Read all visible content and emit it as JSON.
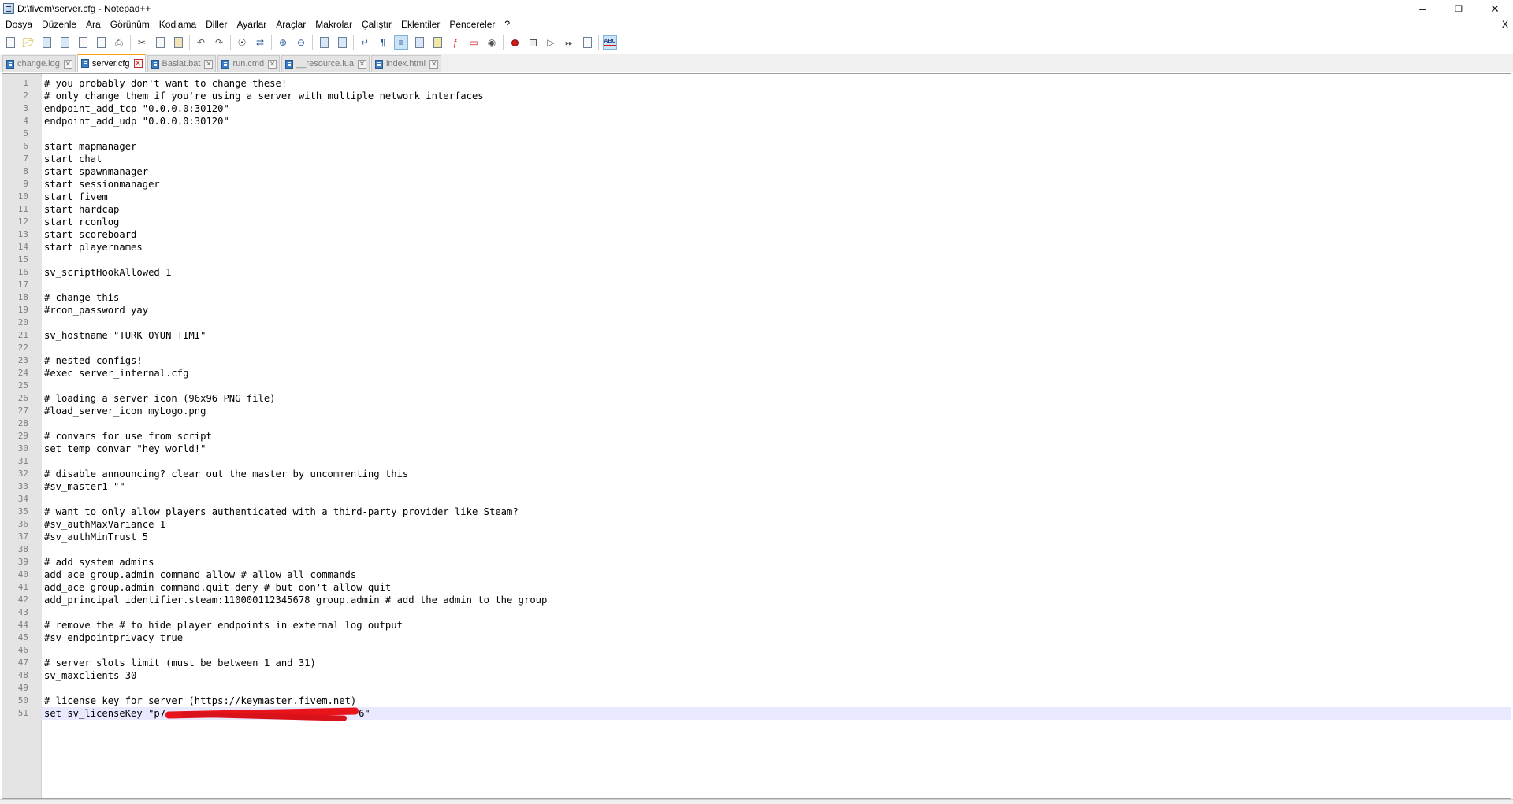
{
  "window": {
    "title": "D:\\fivem\\server.cfg - Notepad++",
    "minimize_icon": "minimize-icon",
    "maximize_icon": "restore-icon",
    "close_icon": "close-icon"
  },
  "menu": {
    "items": [
      "Dosya",
      "Düzenle",
      "Ara",
      "Görünüm",
      "Kodlama",
      "Diller",
      "Ayarlar",
      "Araçlar",
      "Makrolar",
      "Çalıştır",
      "Eklentiler",
      "Pencereler",
      "?"
    ],
    "close_label": "X"
  },
  "toolbar": {
    "icons": [
      "new-file-icon",
      "open-file-icon",
      "save-icon",
      "save-all-icon",
      "close-icon",
      "close-all-icon",
      "print-icon",
      "cut-icon",
      "copy-icon",
      "paste-icon",
      "undo-icon",
      "redo-icon",
      "find-icon",
      "replace-icon",
      "zoom-in-icon",
      "zoom-out-icon",
      "sync-vertical-icon",
      "sync-horizontal-icon",
      "word-wrap-icon",
      "show-all-chars-icon",
      "indent-guide-icon",
      "doc-map-icon",
      "function-list-icon",
      "folder-workspace-icon",
      "monitoring-icon",
      "eye-icon",
      "record-macro-icon",
      "stop-macro-icon",
      "play-macro-icon",
      "run-macro-multiple-icon",
      "save-macro-icon",
      "spell-check-icon"
    ]
  },
  "tabs": [
    {
      "label": "change.log",
      "active": false
    },
    {
      "label": "server.cfg",
      "active": true
    },
    {
      "label": "Baslat.bat",
      "active": false
    },
    {
      "label": "run.cmd",
      "active": false
    },
    {
      "label": "__resource.lua",
      "active": false
    },
    {
      "label": "index.html",
      "active": false
    }
  ],
  "editor": {
    "current_line": 51,
    "lines": [
      "# you probably don't want to change these!",
      "# only change them if you're using a server with multiple network interfaces",
      "endpoint_add_tcp \"0.0.0.0:30120\"",
      "endpoint_add_udp \"0.0.0.0:30120\"",
      "",
      "start mapmanager",
      "start chat",
      "start spawnmanager",
      "start sessionmanager",
      "start fivem",
      "start hardcap",
      "start rconlog",
      "start scoreboard",
      "start playernames",
      "",
      "sv_scriptHookAllowed 1",
      "",
      "# change this",
      "#rcon_password yay",
      "",
      "sv_hostname \"TURK OYUN TIMI\"",
      "",
      "# nested configs!",
      "#exec server_internal.cfg",
      "",
      "# loading a server icon (96x96 PNG file)",
      "#load_server_icon myLogo.png",
      "",
      "# convars for use from script",
      "set temp_convar \"hey world!\"",
      "",
      "# disable announcing? clear out the master by uncommenting this",
      "#sv_master1 \"\"",
      "",
      "# want to only allow players authenticated with a third-party provider like Steam?",
      "#sv_authMaxVariance 1",
      "#sv_authMinTrust 5",
      "",
      "# add system admins",
      "add_ace group.admin command allow # allow all commands",
      "add_ace group.admin command.quit deny # but don't allow quit",
      "add_principal identifier.steam:110000112345678 group.admin # add the admin to the group",
      "",
      "# remove the # to hide player endpoints in external log output",
      "#sv_endpointprivacy true",
      "",
      "# server slots limit (must be between 1 and 31)",
      "sv_maxclients 30",
      "",
      "# license key for server (https://keymaster.fivem.net)"
    ],
    "last_line_prefix": "set sv_licenseKey \"p7",
    "last_line_suffix": "6\""
  }
}
